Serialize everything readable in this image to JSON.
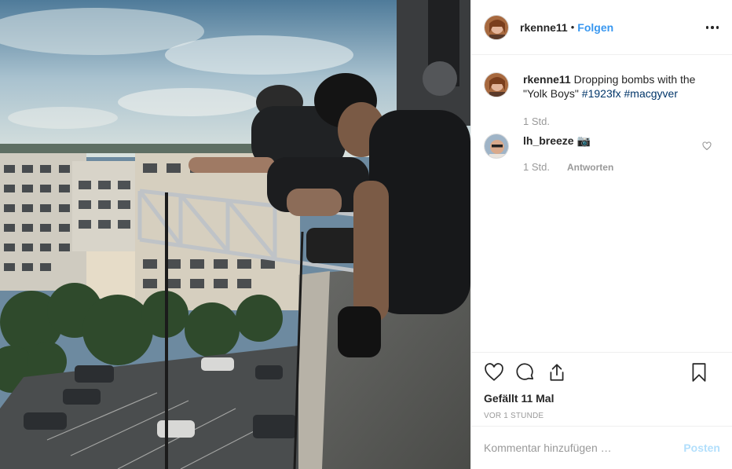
{
  "header": {
    "username": "rkenne11",
    "separator": "•",
    "follow_label": "Folgen",
    "more_icon": "more-horizontal-icon"
  },
  "caption": {
    "username": "rkenne11",
    "text": " Dropping bombs with the \"Yolk Boys\" ",
    "tag1": "#1923fx",
    "tag2": "#macgyver",
    "time": "1 Std."
  },
  "comments": [
    {
      "username": "lh_breeze",
      "text": "📷",
      "time": "1 Std.",
      "reply_label": "Antworten"
    }
  ],
  "actions": {
    "like_icon": "heart-icon",
    "comment_icon": "comment-icon",
    "share_icon": "share-icon",
    "save_icon": "bookmark-icon",
    "likes_text": "Gefällt 11 Mal",
    "timestamp": "VOR 1 STUNDE"
  },
  "add_comment": {
    "placeholder": "Kommentar hinzufügen …",
    "post_label": "Posten"
  },
  "colors": {
    "link_blue": "#3897f0",
    "hashtag": "#003569",
    "post_disabled": "#b2dffc",
    "secondary_text": "#999999"
  }
}
